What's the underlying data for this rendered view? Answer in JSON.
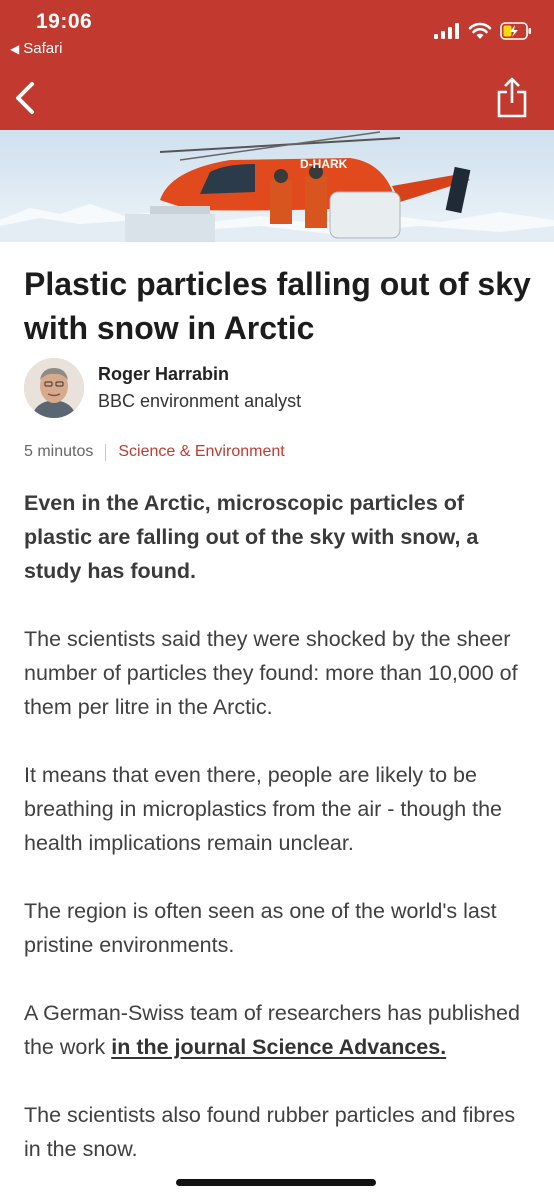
{
  "status_bar": {
    "time": "19:06",
    "back_app": "Safari",
    "icons": [
      "signal-icon",
      "wifi-icon",
      "battery-charging-icon"
    ]
  },
  "nav": {
    "back_icon": "chevron-left-icon",
    "share_icon": "share-icon",
    "brand_color": "#c23a2f"
  },
  "hero": {
    "helicopter_registration": "D-HARK"
  },
  "article": {
    "title": "Plastic particles falling out of sky with snow in Arctic",
    "author": {
      "name": "Roger Harrabin",
      "role": "BBC environment analyst"
    },
    "meta": {
      "read_time": "5 minutos",
      "topic": "Science & Environment"
    },
    "lead": "Even in the Arctic, microscopic particles of plastic are falling out of the sky with snow, a study has found.",
    "paragraphs": [
      "The scientists said they were shocked by the sheer number of particles they found: more than 10,000 of them per litre in the Arctic.",
      "It means that even there, people are likely to be breathing in microplastics from the air - though the health implications remain unclear.",
      "The region is often seen as one of the world's last pristine environments."
    ],
    "link_paragraph": {
      "before": "A German-Swiss team of researchers has published the work ",
      "link_text": "in the journal Science Advances."
    },
    "last_paragraph": "The scientists also found rubber particles and fibres in the snow."
  }
}
